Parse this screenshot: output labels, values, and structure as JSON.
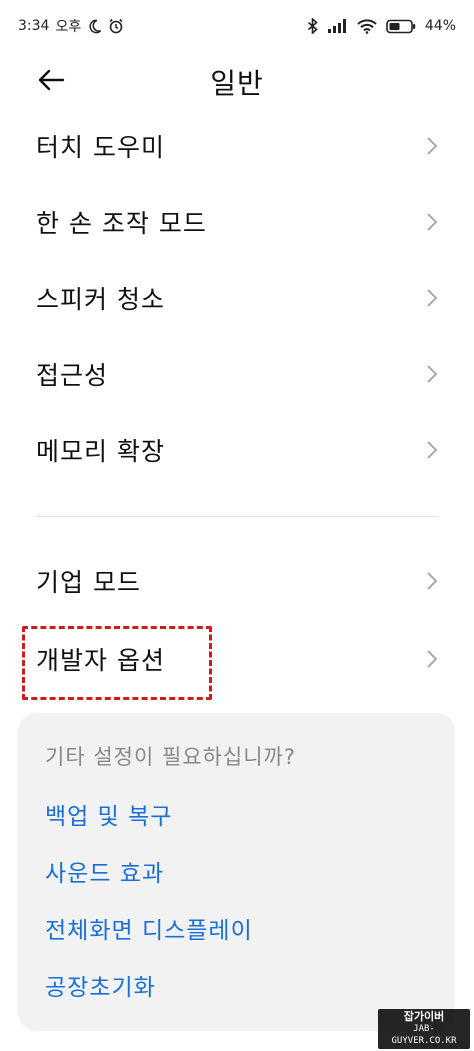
{
  "status_bar": {
    "time": "3:34",
    "ampm": "오후",
    "battery_percent": "44%",
    "icons": [
      "moon-icon",
      "alarm-icon",
      "bluetooth-icon",
      "signal-icon",
      "wifi-icon",
      "battery-icon"
    ]
  },
  "header": {
    "title": "일반",
    "back_icon": "arrow-left-icon"
  },
  "menu": {
    "items": [
      {
        "label": "터치 도우미"
      },
      {
        "label": "한 손 조작 모드"
      },
      {
        "label": "스피커 청소"
      },
      {
        "label": "접근성"
      },
      {
        "label": "메모리 확장"
      },
      {
        "label": "기업 모드"
      },
      {
        "label": "개발자 옵션"
      }
    ],
    "highlighted_item": "개발자 옵션",
    "highlight_color": "#d11b1b"
  },
  "suggestions": {
    "title": "기타 설정이 필요하십니까?",
    "links": [
      {
        "label": "백업 및 복구"
      },
      {
        "label": "사운드 효과"
      },
      {
        "label": "전체화면 디스플레이"
      },
      {
        "label": "공장초기화"
      }
    ],
    "link_color": "#1a6fd6"
  },
  "watermark": {
    "line1": "잡가이버",
    "line2": "JAB-GUYVER.CO.KR"
  }
}
